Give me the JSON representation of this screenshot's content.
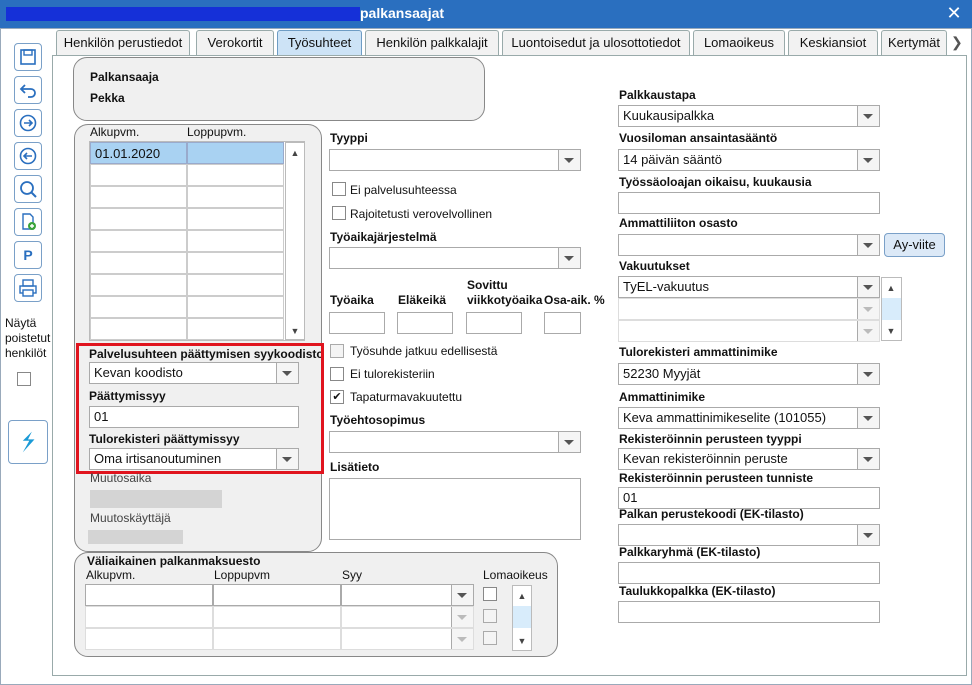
{
  "window": {
    "title": "palkansaajat"
  },
  "tabs": [
    {
      "label": "Henkilön perustiedot",
      "active": false
    },
    {
      "label": "Verokortit",
      "active": false
    },
    {
      "label": "Työsuhteet",
      "active": true
    },
    {
      "label": "Henkilön palkkalajit",
      "active": false
    },
    {
      "label": "Luontoisedut ja ulosottotiedot",
      "active": false
    },
    {
      "label": "Lomaoikeus",
      "active": false
    },
    {
      "label": "Keskiansiot",
      "active": false
    },
    {
      "label": "Kertymät",
      "active": false
    }
  ],
  "toolbar": {
    "icons": [
      "save-icon",
      "undo-icon",
      "next-icon",
      "previous-icon",
      "search-icon",
      "add-document-icon",
      "p-icon",
      "print-icon",
      "app-logo-icon"
    ],
    "p_label": "P",
    "show_deleted_label": "Näytä poistetut henkilöt"
  },
  "payee": {
    "label": "Palkansaaja",
    "name": "Pekka"
  },
  "period_grid": {
    "col_start": "Alkupvm.",
    "col_end": "Loppupvm.",
    "rows": [
      {
        "start": "01.01.2020",
        "end": ""
      }
    ]
  },
  "termination": {
    "code_system_label": "Palvelusuhteen päättymisen syykoodisto",
    "code_system_value": "Kevan koodisto",
    "reason_label": "Päättymissyy",
    "reason_value": "01",
    "income_reason_label": "Tulorekisteri päättymissyy",
    "income_reason_value": "Oma irtisanoutuminen"
  },
  "change": {
    "time_label": "Muutosaika",
    "user_label": "Muutoskäyttäjä"
  },
  "middle": {
    "type_label": "Tyyppi",
    "type_value": "",
    "not_employment_label": "Ei palvelusuhteessa",
    "limited_tax_label": "Rajoitetusti verovelvollinen",
    "worktime_system_label": "Työaikajärjestelmä",
    "worktime_label": "Työaika",
    "pension_age_label": "Eläkeikä",
    "agreed_weekly_label_1": "Sovittu",
    "agreed_weekly_label_2": "viikkotyöaika",
    "part_time_label": "Osa-aik. %",
    "continues_label": "Työsuhde jatkuu edellisestä",
    "no_income_reg_label": "Ei tulorekisteriin",
    "accident_ins_label": "Tapaturmavakuutettu",
    "accident_ins_checked": "✔",
    "collective_label": "Työehtosopimus",
    "additional_label": "Lisätieto"
  },
  "temp_payment": {
    "title": "Väliaikainen palkanmaksuesto",
    "col_start": "Alkupvm.",
    "col_end": "Loppupvm",
    "col_reason": "Syy",
    "col_holiday": "Lomaoikeus"
  },
  "right": {
    "pay_method_label": "Palkkaustapa",
    "pay_method_value": "Kuukausipalkka",
    "holiday_rule_label": "Vuosiloman ansaintasääntö",
    "holiday_rule_value": "14 päivän sääntö",
    "employer_right_label": "Työssäoloajan oikaisu, kuukausia",
    "employer_right_value": "",
    "union_label": "Ammattiliiton osasto",
    "union_value": "",
    "union_button": "Ay-viite",
    "insurance_label": "Vakuutukset",
    "insurance_value": "TyEL-vakuutus",
    "income_title_label": "Tulorekisteri ammattinimike",
    "income_title_value": "52230 Myyjät",
    "job_title_label": "Ammattinimike",
    "job_title_value": "Keva ammattinimikeselite (101055)",
    "reg_basis_type_label": "Rekisteröinnin perusteen tyyppi",
    "reg_basis_type_value": "Kevan rekisteröinnin peruste",
    "reg_basis_id_label": "Rekisteröinnin perusteen tunniste",
    "reg_basis_id_value": "01",
    "pay_basis_code_label": "Palkan perustekoodi (EK-tilasto)",
    "pay_group_label": "Palkkaryhmä (EK-tilasto)",
    "table_pay_label": "Taulukkopalkka (EK-tilasto)"
  },
  "colors": {
    "titlebar": "#2a6fbf",
    "active_tab": "#cde3f6",
    "highlight": "#e0141e",
    "selected_row": "#a9d2f2"
  }
}
